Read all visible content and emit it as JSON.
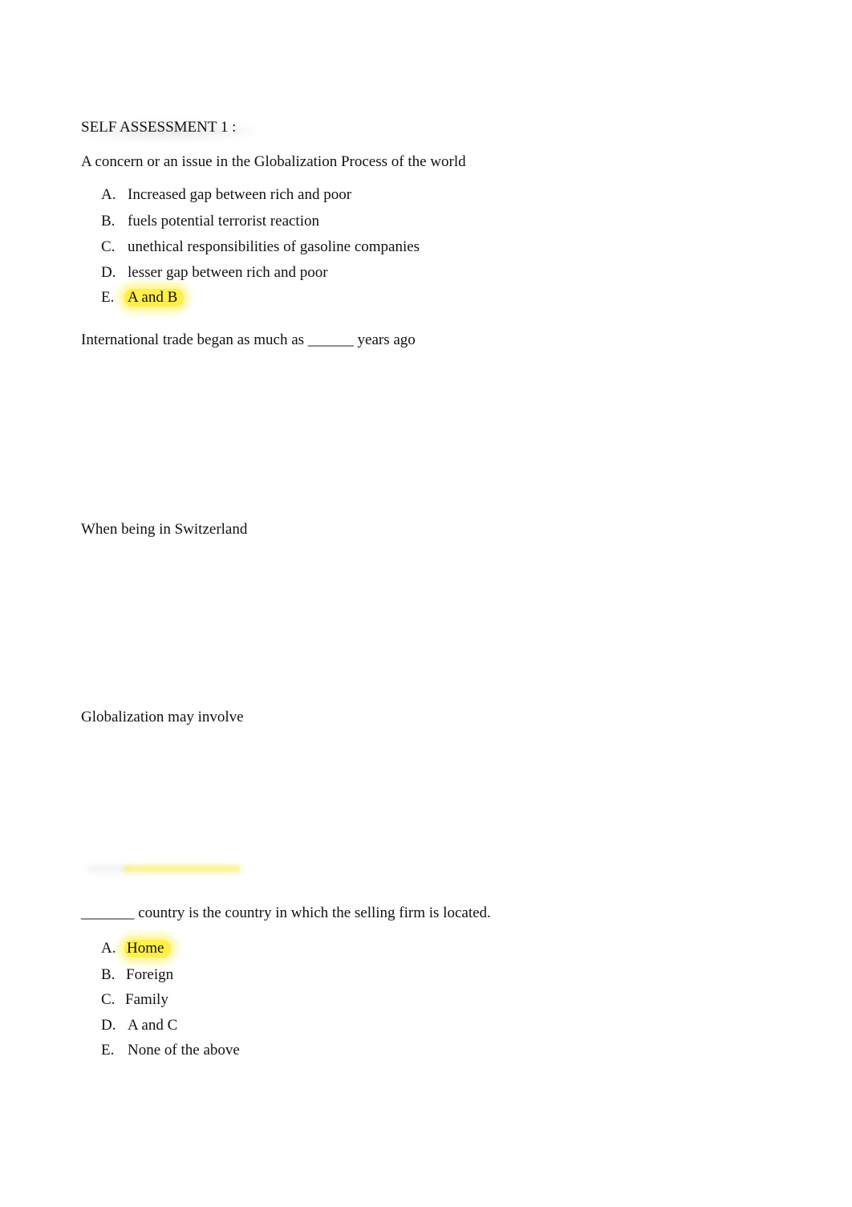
{
  "document": {
    "heading": "SELF ASSESSMENT 1 :",
    "questions": [
      {
        "prompt": "A concern or an issue in the Globalization Process of the world",
        "options": [
          {
            "letter": "A.",
            "text": "Increased gap between rich and poor",
            "highlighted": false
          },
          {
            "letter": "B.",
            "text": "fuels potential terrorist reaction",
            "highlighted": false
          },
          {
            "letter": "C.",
            "text": "unethical responsibilities of gasoline companies",
            "highlighted": false
          },
          {
            "letter": "D.",
            "text": "lesser gap between rich and poor",
            "highlighted": false
          },
          {
            "letter": "E.",
            "text": "A and B",
            "highlighted": true
          }
        ]
      },
      {
        "prompt": "International trade began as much as ______ years ago",
        "options": []
      },
      {
        "prompt": "When being in Switzerland",
        "options": []
      },
      {
        "prompt": "Globalization may involve",
        "options": []
      },
      {
        "prompt": "_______ country is the country in which the selling firm is located.",
        "options": [
          {
            "letter": "A.",
            "text": "Home",
            "highlighted": true
          },
          {
            "letter": "B.",
            "text": "Foreign",
            "highlighted": false
          },
          {
            "letter": "C.",
            "text": "Family",
            "highlighted": false
          },
          {
            "letter": "D.",
            "text": "A and C",
            "highlighted": false
          },
          {
            "letter": "E.",
            "text": "None of the above",
            "highlighted": false
          }
        ]
      }
    ],
    "highlight_color": "#ffec28"
  }
}
